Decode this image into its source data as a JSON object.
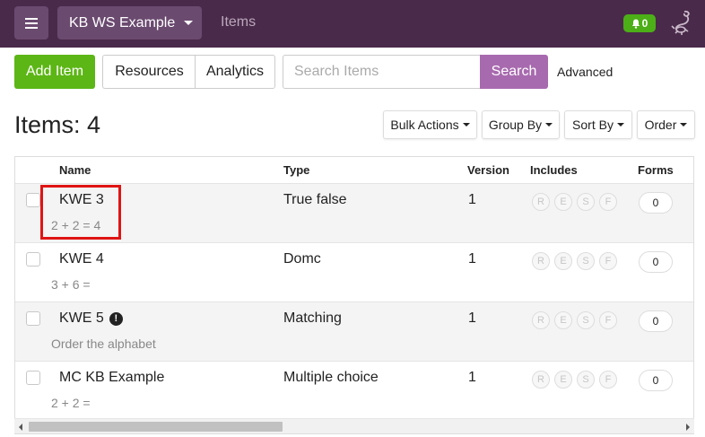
{
  "topbar": {
    "workspace_label": "KB WS Example",
    "breadcrumb": "Items",
    "notification_count": "0"
  },
  "toolbar": {
    "add_label": "Add Item",
    "resources_label": "Resources",
    "analytics_label": "Analytics",
    "search_placeholder": "Search Items",
    "search_label": "Search",
    "advanced_label": "Advanced"
  },
  "page": {
    "title": "Items: 4",
    "bulk_actions": "Bulk Actions",
    "group_by": "Group By",
    "sort_by": "Sort By",
    "order": "Order"
  },
  "table": {
    "headers": {
      "name": "Name",
      "type": "Type",
      "version": "Version",
      "includes": "Includes",
      "forms": "Forms"
    },
    "include_letters": [
      "R",
      "E",
      "S",
      "F"
    ],
    "rows": [
      {
        "name": "KWE 3",
        "sub": "2 + 2 = 4",
        "type": "True false",
        "version": "1",
        "forms": "0",
        "warning": false
      },
      {
        "name": "KWE 4",
        "sub": "3 + 6 =",
        "type": "Domc",
        "version": "1",
        "forms": "0",
        "warning": false
      },
      {
        "name": "KWE 5",
        "sub": "Order the alphabet",
        "type": "Matching",
        "version": "1",
        "forms": "0",
        "warning": true
      },
      {
        "name": "MC KB Example",
        "sub": "2 + 2 =",
        "type": "Multiple choice",
        "version": "1",
        "forms": "0",
        "warning": false
      }
    ]
  },
  "colors": {
    "topbar": "#4a2a4a",
    "accent_purple": "#a86aaf",
    "add_green": "#5cb615",
    "highlight_red": "#e01414"
  },
  "icons": {
    "menu": "hamburger-icon",
    "bell": "bell-icon",
    "logo": "scorpion-logo-icon",
    "warning": "exclamation-circle-icon"
  }
}
